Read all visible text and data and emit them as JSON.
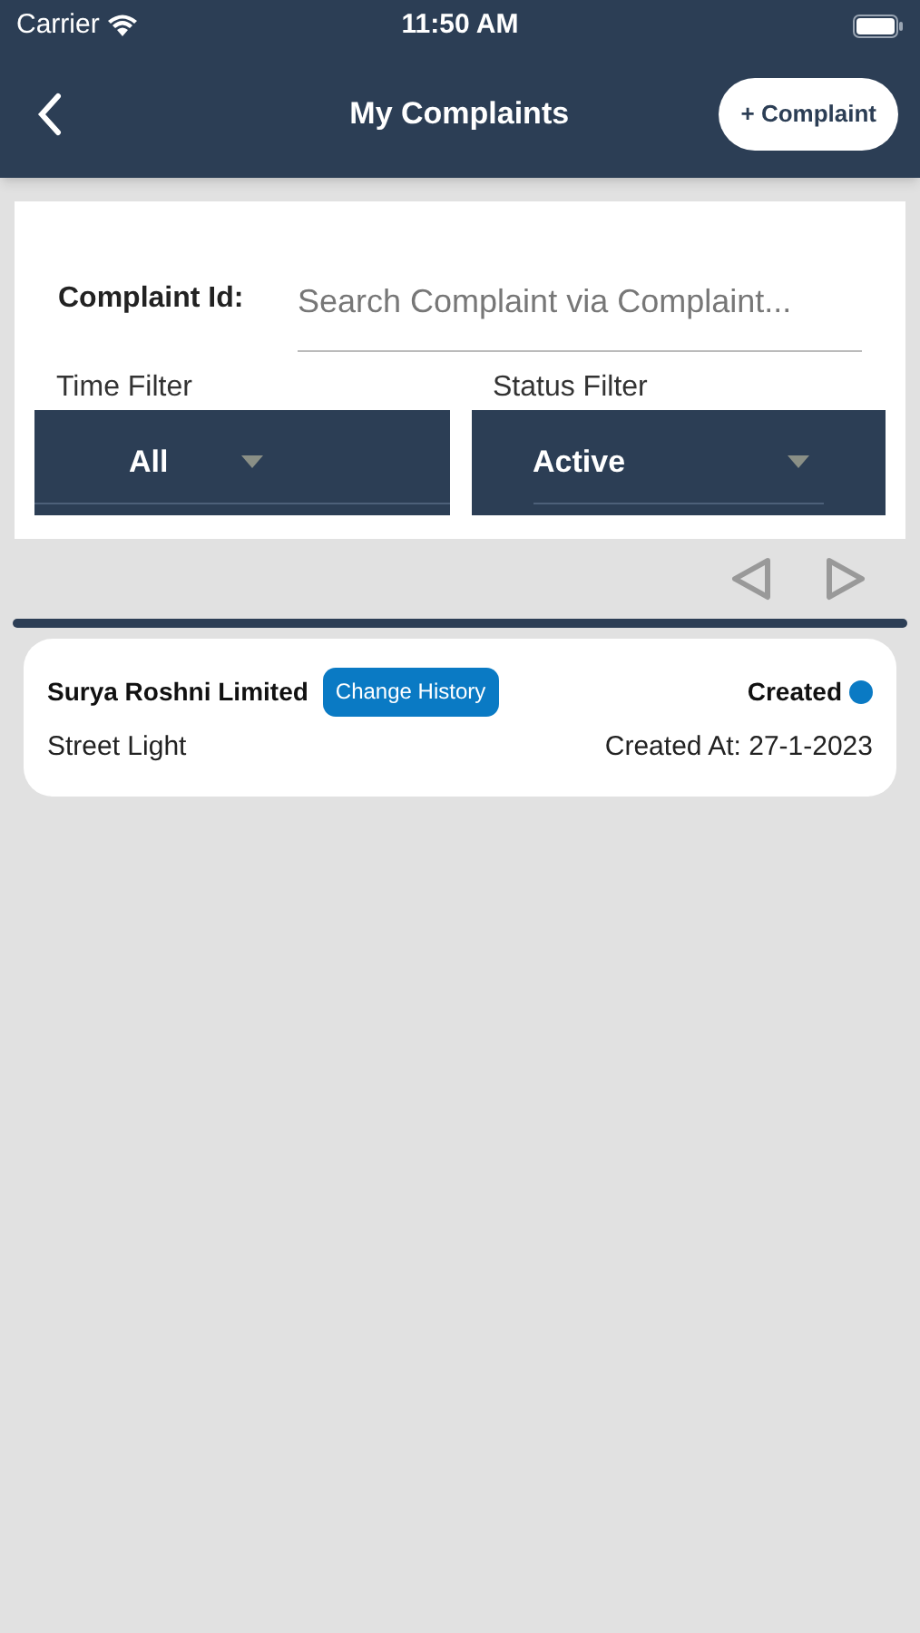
{
  "status_bar": {
    "carrier": "Carrier",
    "time": "11:50 AM"
  },
  "header": {
    "title": "My Complaints",
    "add_button": "+ Complaint"
  },
  "filters": {
    "complaint_id_label": "Complaint Id:",
    "search_placeholder": "Search Complaint via Complaint...",
    "time_filter": {
      "label": "Time Filter",
      "value": "All"
    },
    "status_filter": {
      "label": "Status Filter",
      "value": "Active"
    }
  },
  "complaints": [
    {
      "company": "Surya Roshni Limited",
      "history_button": "Change History",
      "status": "Created",
      "color": "#0a7ac4",
      "category": "Street Light",
      "created_at": "Created At: 27-1-2023"
    }
  ]
}
